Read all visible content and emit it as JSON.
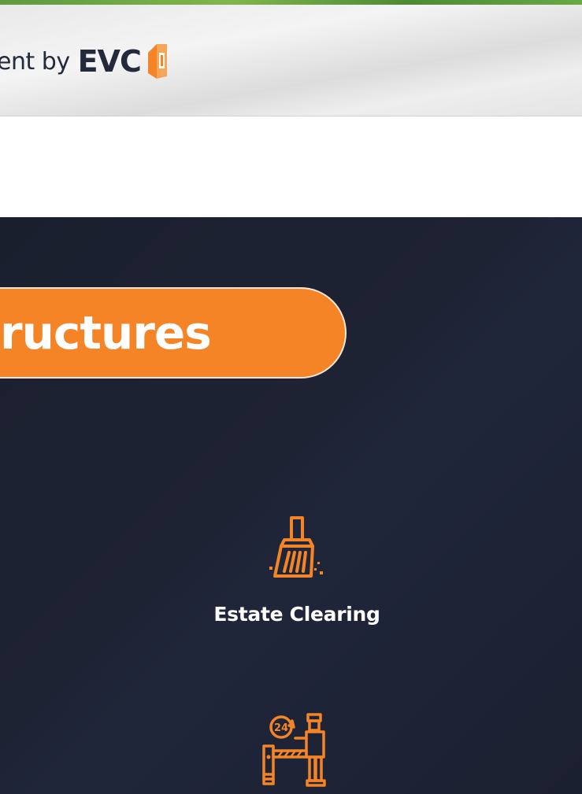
{
  "header": {
    "text_fragment": "ent by",
    "brand": "EVC",
    "brand_icon": "evc-logo-icon"
  },
  "section": {
    "heading_fragment": "ructures",
    "accent_color": "#f58426",
    "background_color": "#1e2334"
  },
  "features": [
    {
      "label": "Estate Clearing",
      "icon": "broom-icon"
    },
    {
      "label": "",
      "icon": "security-guard-barrier-24h-icon"
    }
  ]
}
